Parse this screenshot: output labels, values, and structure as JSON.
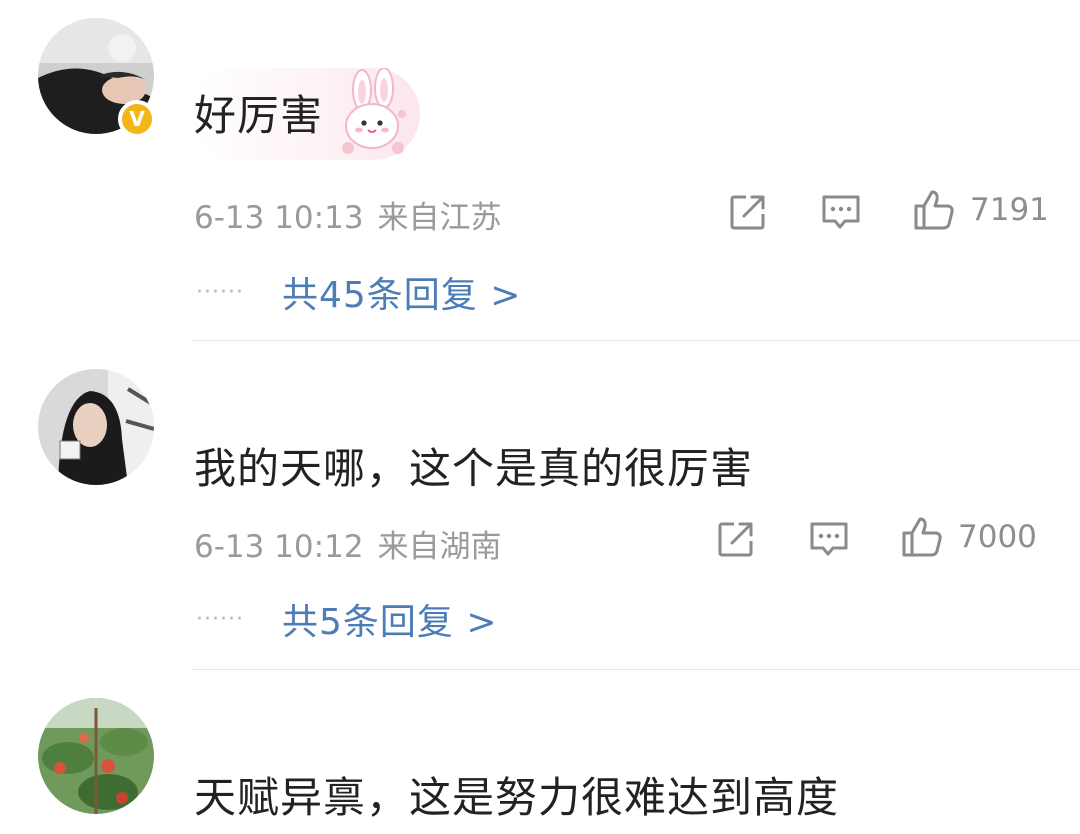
{
  "comments": [
    {
      "text": "好厉害",
      "time": "6-13 10:13",
      "location": "来自江苏",
      "likes": "7191",
      "replies": "共45条回复 >",
      "verified_mark": "V",
      "icons": [
        "share-icon",
        "comment-icon",
        "like-icon"
      ]
    },
    {
      "text": "我的天哪，这个是真的很厉害",
      "time": "6-13 10:12",
      "location": "来自湖南",
      "likes": "7000",
      "replies": "共5条回复 >",
      "icons": [
        "share-icon",
        "comment-icon",
        "like-icon"
      ]
    },
    {
      "text": "天赋异禀，这是努力很难达到高度"
    }
  ],
  "replies_dots": "······",
  "colors": {
    "link_blue": "#4d7db6",
    "meta_gray": "#9a9a9a",
    "badge_gold": "#f3b619"
  }
}
